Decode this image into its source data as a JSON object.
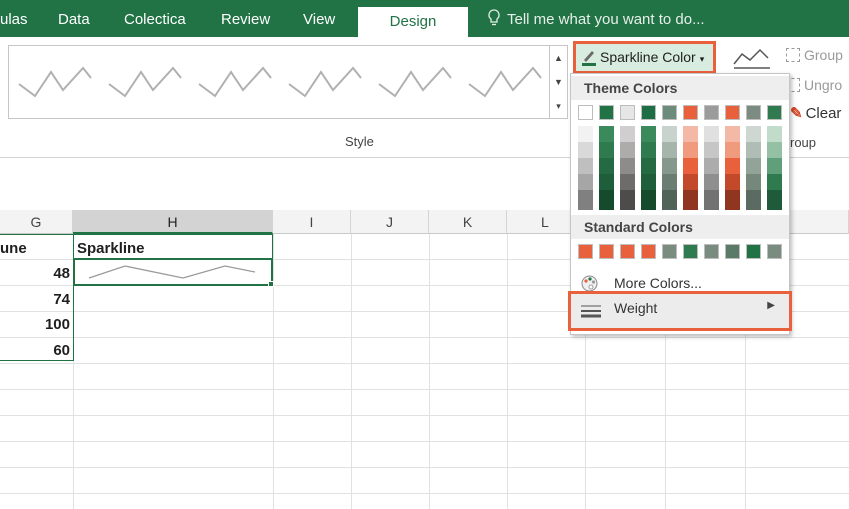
{
  "ribbon": {
    "tabs": [
      "ulas",
      "Data",
      "Colectica",
      "Review",
      "View",
      "Design"
    ],
    "active_tab": "Design",
    "tell_me": "Tell me what you want to do...",
    "style_group_label": "Style",
    "sparkline_color_label": "Sparkline Color",
    "right_group": {
      "group_label": "Group",
      "ungroup_label": "Ungro",
      "clear_label": "Clear",
      "footer_label": "roup"
    }
  },
  "dropdown": {
    "theme_header": "Theme Colors",
    "standard_header": "Standard Colors",
    "more_colors": "More Colors...",
    "weight": "Weight",
    "theme_top_row": [
      "#ffffff",
      "#217346",
      "#e7e6e6",
      "#1e6e45",
      "#6e8c7c",
      "#e8603c",
      "#9b9b9b",
      "#e8603c",
      "#7c8c82",
      "#2f7a4f"
    ],
    "standard_row": [
      "#e8603c",
      "#e8603c",
      "#e8603c",
      "#e8603c",
      "#7a8c80",
      "#2f7a4f",
      "#7a8c80",
      "#5c7a68",
      "#217346",
      "#7a8c80"
    ]
  },
  "sheet": {
    "columns": [
      "G",
      "H",
      "I",
      "J",
      "K",
      "L"
    ],
    "selected_column": "H",
    "g_header": "une",
    "sparkline_header": "Sparkline",
    "values": [
      "48",
      "74",
      "100",
      "60"
    ]
  }
}
